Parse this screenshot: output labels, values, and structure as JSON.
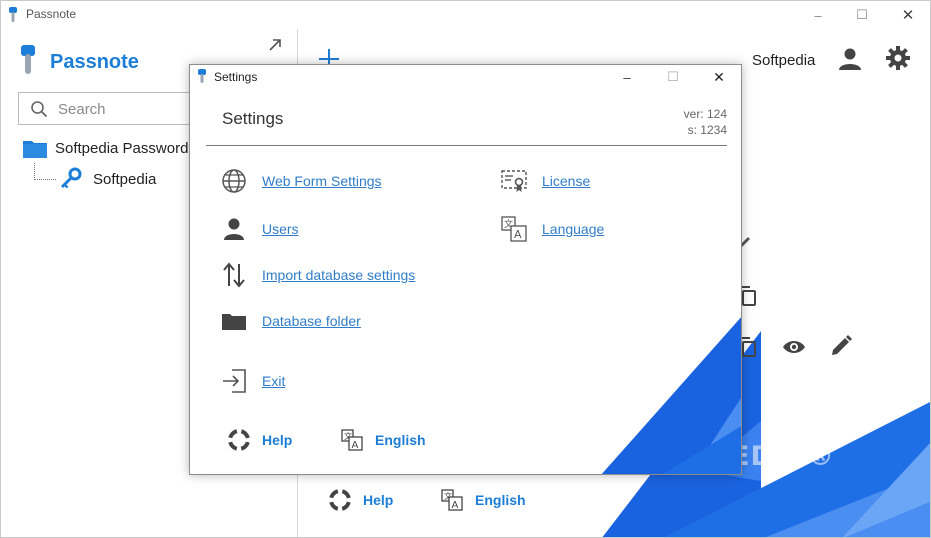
{
  "window": {
    "title": "Passnote",
    "controls": {
      "minimize": "–",
      "maximize": "☐",
      "close": "✕"
    }
  },
  "sidebar": {
    "brand": "Passnote",
    "search": {
      "placeholder": "Search"
    },
    "tree": {
      "folder": "Softpedia Passwords",
      "items": [
        {
          "label": "Softpedia",
          "icon": "key-icon"
        }
      ]
    }
  },
  "header": {
    "user": "Softpedia"
  },
  "footer": {
    "help": "Help",
    "language": "English"
  },
  "watermark": "SOFTPEDIA®",
  "settings_dialog": {
    "title": "Settings",
    "controls": {
      "minimize": "–",
      "maximize": "☐",
      "close": "✕"
    },
    "heading": "Settings",
    "version": "ver: 124",
    "build": "s: 1234",
    "left_options": [
      {
        "label": "Web Form Settings",
        "icon": "globe-icon"
      },
      {
        "label": "Users",
        "icon": "user-icon"
      },
      {
        "label": "Import database settings",
        "icon": "import-arrows-icon"
      },
      {
        "label": "Database folder",
        "icon": "folder-icon"
      },
      {
        "label": "Exit",
        "icon": "exit-icon"
      }
    ],
    "right_options": [
      {
        "label": "License",
        "icon": "certificate-icon"
      },
      {
        "label": "Language",
        "icon": "translate-icon"
      }
    ],
    "help": "Help",
    "language": "English"
  },
  "colors": {
    "accent": "#1c7ed6",
    "link": "#2f7dc8",
    "decor_blue": "#1e6fe6"
  }
}
